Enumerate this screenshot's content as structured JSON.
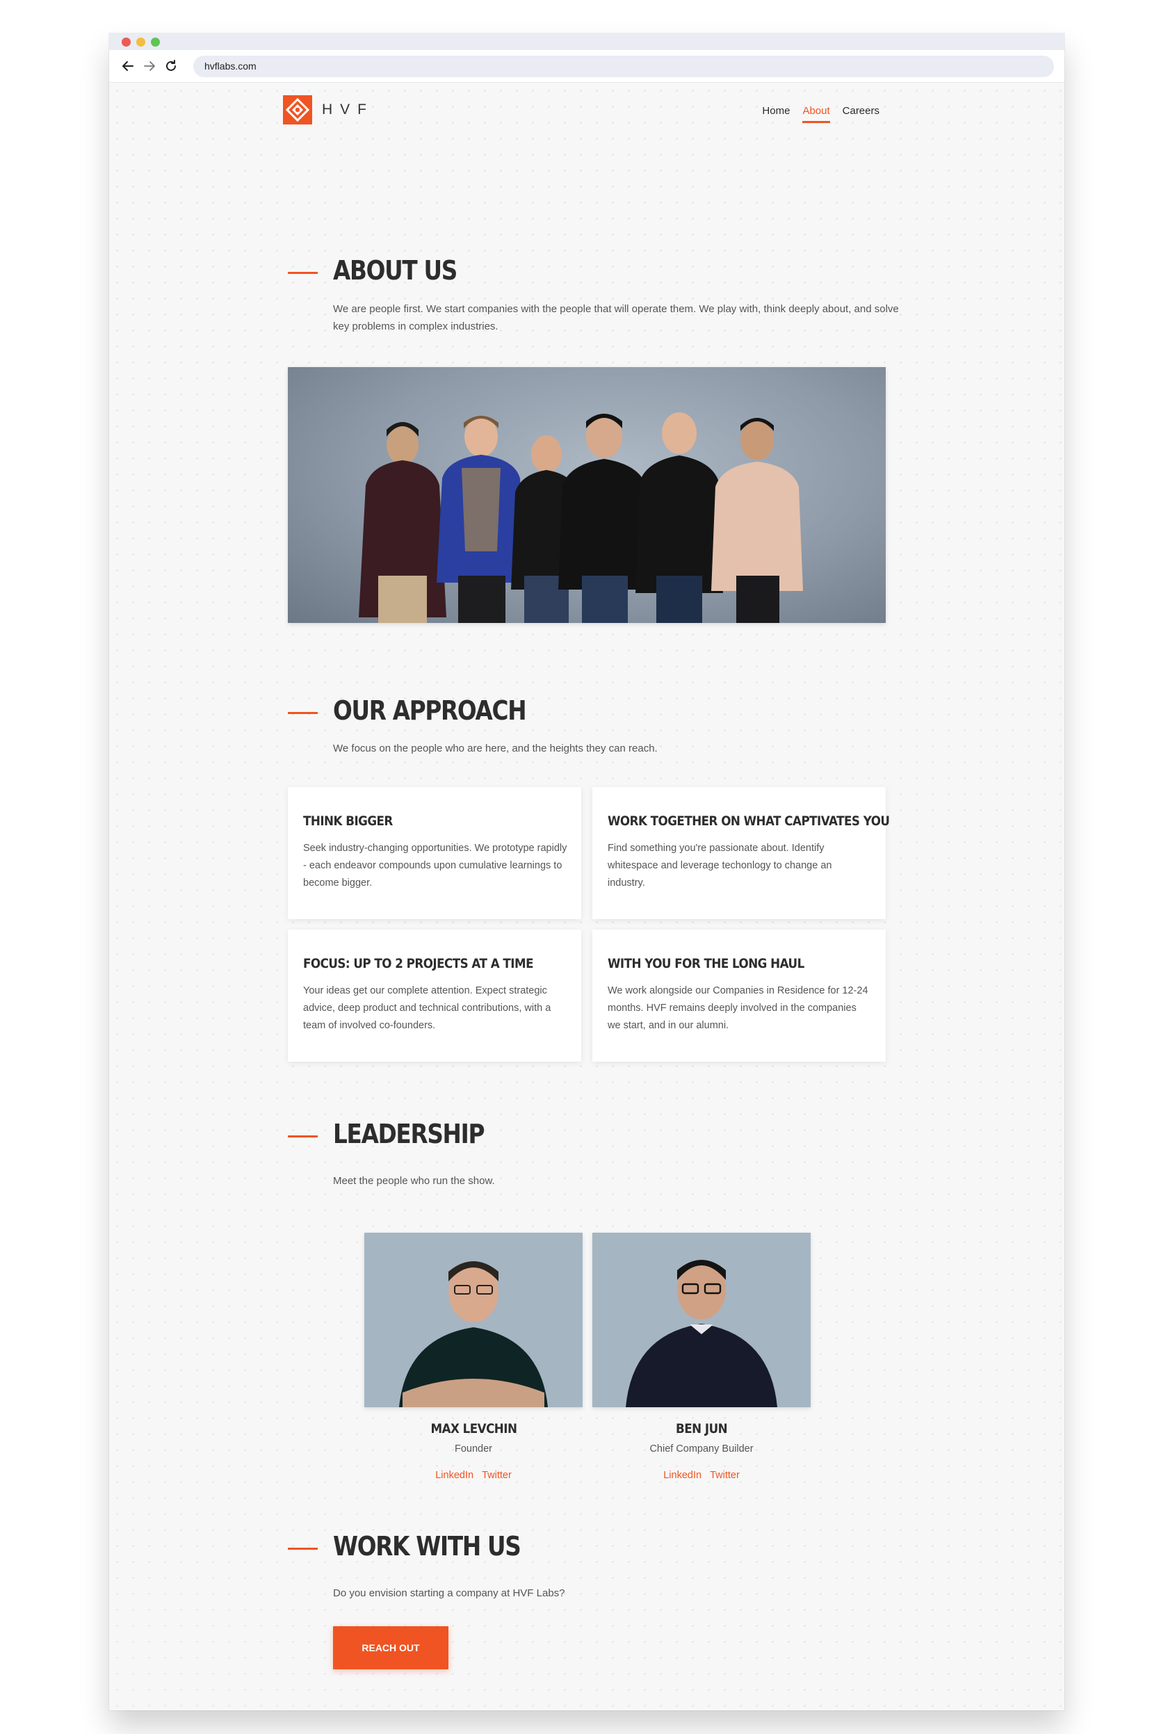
{
  "browser": {
    "url": "hvflabs.com"
  },
  "site": {
    "logo_text": "HVF",
    "accent_color": "#f05423",
    "nav": [
      {
        "label": "Home",
        "active": false
      },
      {
        "label": "About",
        "active": true
      },
      {
        "label": "Careers",
        "active": false
      }
    ]
  },
  "about": {
    "title": "ABOUT US",
    "lead": "We are people first. We start companies with the people that will operate them. We play with, think deeply about, and solve key problems in complex industries."
  },
  "approach": {
    "title": "OUR APPROACH",
    "lead": "We focus on the people who are here, and the heights they can reach.",
    "cards": [
      {
        "title": "THINK BIGGER",
        "body": "Seek industry-changing opportunities. We prototype rapidly - each endeavor compounds upon cumulative learnings to become bigger."
      },
      {
        "title": "WORK TOGETHER ON WHAT CAPTIVATES YOU",
        "body": "Find something you're passionate about. Identify whitespace and leverage techonlogy to change an industry."
      },
      {
        "title": "FOCUS: UP TO 2 PROJECTS AT A TIME",
        "body": "Your ideas get our complete attention. Expect strategic advice, deep product and technical contributions, with a team of involved co-founders."
      },
      {
        "title": "WITH YOU FOR THE LONG HAUL",
        "body": "We work alongside our Companies in Residence for 12-24 months. HVF remains deeply involved in the companies we start, and in our alumni."
      }
    ]
  },
  "leadership": {
    "title": "LEADERSHIP",
    "lead": "Meet the people who run the show.",
    "people": [
      {
        "name": "MAX LEVCHIN",
        "role": "Founder",
        "linkedin": "LinkedIn",
        "twitter": "Twitter"
      },
      {
        "name": "BEN JUN",
        "role": "Chief Company Builder",
        "linkedin": "LinkedIn",
        "twitter": "Twitter"
      }
    ]
  },
  "work": {
    "title": "WORK WITH US",
    "lead": "Do you envision starting a company at HVF Labs?",
    "button": "REACH OUT"
  }
}
